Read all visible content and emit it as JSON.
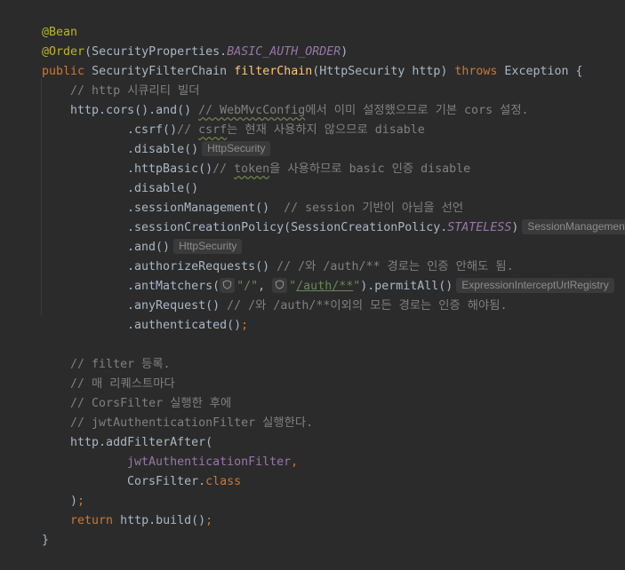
{
  "lines": {
    "l1": {
      "t0": "@Bean"
    },
    "l2": {
      "t0": "@Order",
      "t1": "(SecurityProperties.",
      "t2": "BASIC_AUTH_ORDER",
      "t3": ")"
    },
    "l3": {
      "t0": "public",
      "t1": " SecurityFilterChain ",
      "t2": "filterChain",
      "t3": "(HttpSecurity http) ",
      "t4": "throws",
      "t5": " Exception {"
    },
    "l4": {
      "t0": "// http 시큐리티 빌더"
    },
    "l5": {
      "t0": "http.cors().and() ",
      "t1": "// WebMvcConfig",
      "t2": "에서 이미 설정했으므로 기본 cors 설정."
    },
    "l6": {
      "t0": ".csrf()",
      "t1": "// ",
      "t2": "csrf",
      "t3": "는 현재 사용하지 않으므로 disable"
    },
    "l7": {
      "t0": ".disable()",
      "hint": "HttpSecurity"
    },
    "l8": {
      "t0": ".httpBasic()",
      "t1": "// ",
      "t2": "token",
      "t3": "을 사용하므로 basic 인증 disable"
    },
    "l9": {
      "t0": ".disable()"
    },
    "l10": {
      "t0": ".sessionManagement()  ",
      "t1": "// session 기반이 아님을 선언"
    },
    "l11": {
      "t0": ".sessionCreationPolicy(SessionCreationPolicy.",
      "t1": "STATELESS",
      "t2": ")",
      "hint": "SessionManagementCor"
    },
    "l12": {
      "t0": ".and()",
      "hint": "HttpSecurity"
    },
    "l13": {
      "t0": ".authorizeRequests() ",
      "t1": "// /와 /auth/** 경로는 인증 안해도 됨."
    },
    "l14": {
      "t0": ".antMatchers(",
      "s1": "\"/\"",
      "t1": ", ",
      "s2": "\"",
      "s3": "/auth/**",
      "s4": "\"",
      "t2": ").permitAll()",
      "hint": "ExpressionInterceptUrlRegistry"
    },
    "l15": {
      "t0": ".anyRequest() ",
      "t1": "// /와 /auth/**이외의 모든 경로는 인증 해야됨."
    },
    "l16": {
      "t0": ".authenticated()",
      "t1": ";"
    },
    "l17": {
      "t0": "// filter 등록."
    },
    "l18": {
      "t0": "// 매 리퀘스트마다"
    },
    "l19": {
      "t0": "// CorsFilter 실행한 후에"
    },
    "l20": {
      "t0": "// jwtAuthenticationFilter 실행한다."
    },
    "l21": {
      "t0": "http.addFilterAfter("
    },
    "l22": {
      "t0": "jwtAuthenticationFilter",
      "t1": ","
    },
    "l23": {
      "t0": "CorsFilter.",
      "t1": "class"
    },
    "l24": {
      "t0": ")",
      "t1": ";"
    },
    "l25": {
      "t0": "return",
      "t1": " http.build()",
      "t2": ";"
    },
    "l26": {
      "t0": "}"
    }
  },
  "icons": {
    "chip": "shield-icon"
  },
  "colors": {
    "background": "#2b2b2b",
    "text": "#a9b7c6",
    "keyword": "#cc7832",
    "annotation": "#bbb529",
    "method": "#ffc66d",
    "comment": "#808080",
    "string": "#6a8759",
    "field": "#9876aa"
  }
}
